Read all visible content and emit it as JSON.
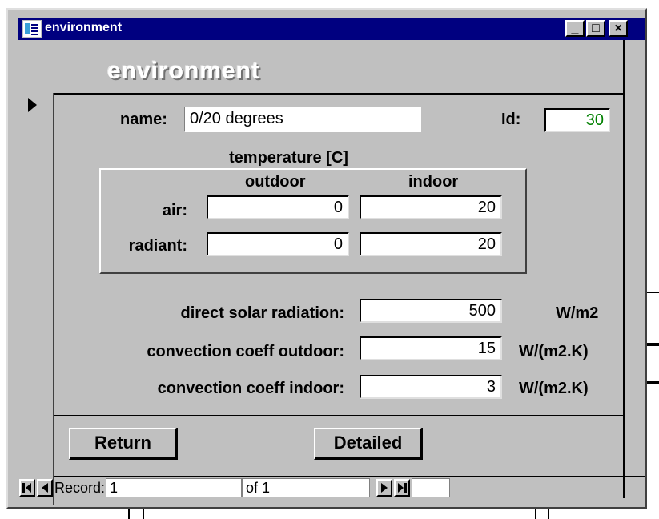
{
  "window": {
    "title": "environment",
    "minimize_glyph": "_",
    "maximize_glyph": "□",
    "close_glyph": "×"
  },
  "form": {
    "heading": "environment",
    "name_label": "name:",
    "name_value": "0/20 degrees",
    "id_label": "Id:",
    "id_value": "30",
    "id_color": "#008000",
    "temperature_label": "temperature [C]",
    "col_outdoor": "outdoor",
    "col_indoor": "indoor",
    "air_label": "air:",
    "air_outdoor": "0",
    "air_indoor": "20",
    "radiant_label": "radiant:",
    "radiant_outdoor": "0",
    "radiant_indoor": "20",
    "solar_label": "direct solar radiation:",
    "solar_value": "500",
    "solar_unit": "W/m2",
    "conv_out_label": "convection coeff outdoor:",
    "conv_out_value": "15",
    "conv_out_unit": "W/(m2.K)",
    "conv_in_label": "convection coeff indoor:",
    "conv_in_value": "3",
    "conv_in_unit": "W/(m2.K)",
    "return_button": "Return",
    "detailed_button": "Detailed"
  },
  "navigation": {
    "record_label": "Record:",
    "record_value": "1",
    "of_label": "of",
    "total": "1"
  },
  "icons": [
    "access-form-icon",
    "minimize-icon",
    "maximize-icon",
    "close-icon",
    "current-record-icon",
    "first-record-icon",
    "previous-record-icon",
    "next-record-icon",
    "last-record-icon"
  ]
}
